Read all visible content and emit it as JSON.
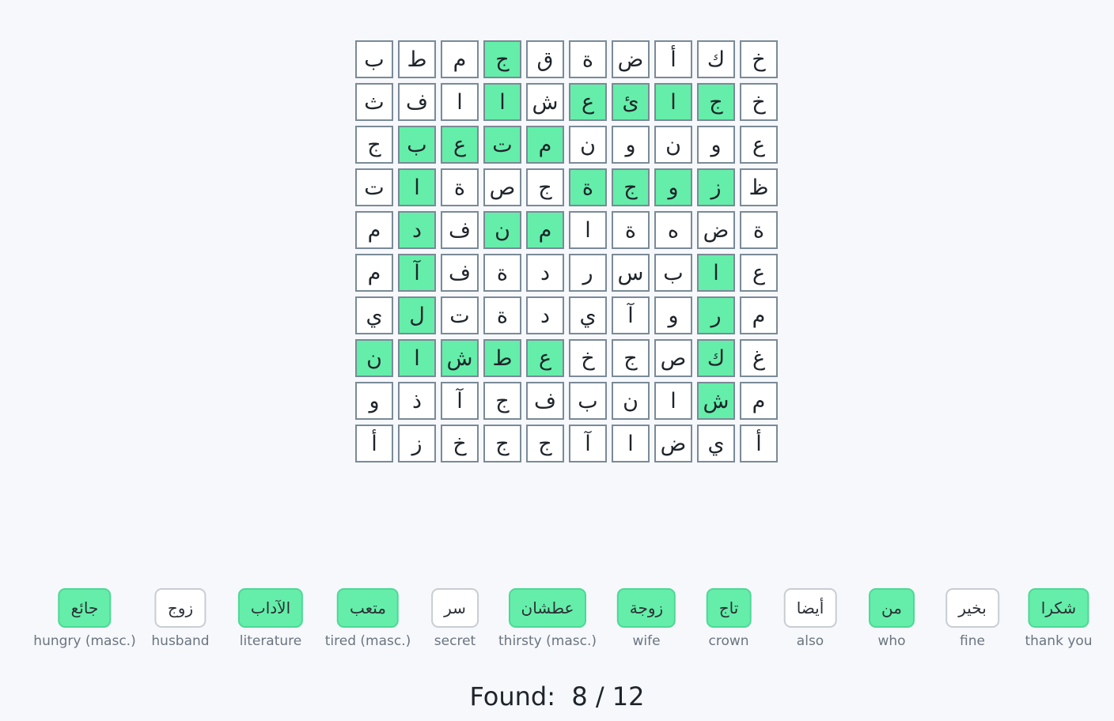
{
  "grid": {
    "rows": [
      [
        "خ",
        "ك",
        "أ",
        "ض",
        "ة",
        "ق",
        "ج",
        "م",
        "ط",
        "ب"
      ],
      [
        "خ",
        "ج",
        "ا",
        "ئ",
        "ع",
        "ش",
        "ا",
        "ا",
        "ف",
        "ث"
      ],
      [
        "ع",
        "و",
        "ن",
        "و",
        "ن",
        "م",
        "ت",
        "ع",
        "ب",
        "ج"
      ],
      [
        "ظ",
        "ز",
        "و",
        "ج",
        "ة",
        "ج",
        "ص",
        "ة",
        "ا",
        "ت"
      ],
      [
        "ة",
        "ض",
        "ه",
        "ة",
        "ا",
        "م",
        "ن",
        "ف",
        "د",
        "م"
      ],
      [
        "ع",
        "ا",
        "ب",
        "س",
        "ر",
        "د",
        "ة",
        "ف",
        "آ",
        "م"
      ],
      [
        "م",
        "ر",
        "و",
        "آ",
        "ي",
        "د",
        "ة",
        "ت",
        "ل",
        "ي"
      ],
      [
        "غ",
        "ك",
        "ص",
        "ج",
        "خ",
        "ع",
        "ط",
        "ش",
        "ا",
        "ن"
      ],
      [
        "م",
        "ش",
        "ا",
        "ن",
        "ب",
        "ف",
        "ج",
        "آ",
        "ذ",
        "و"
      ],
      [
        "أ",
        "ي",
        "ض",
        "ا",
        "آ",
        "ج",
        "ج",
        "خ",
        "ز",
        "أ"
      ]
    ],
    "found_cells": [
      [
        0,
        6
      ],
      [
        1,
        1
      ],
      [
        1,
        2
      ],
      [
        1,
        3
      ],
      [
        1,
        4
      ],
      [
        1,
        6
      ],
      [
        2,
        5
      ],
      [
        2,
        6
      ],
      [
        2,
        7
      ],
      [
        2,
        8
      ],
      [
        3,
        1
      ],
      [
        3,
        2
      ],
      [
        3,
        3
      ],
      [
        3,
        4
      ],
      [
        3,
        8
      ],
      [
        4,
        5
      ],
      [
        4,
        6
      ],
      [
        4,
        8
      ],
      [
        5,
        1
      ],
      [
        5,
        8
      ],
      [
        6,
        1
      ],
      [
        6,
        8
      ],
      [
        7,
        1
      ],
      [
        7,
        5
      ],
      [
        7,
        6
      ],
      [
        7,
        7
      ],
      [
        7,
        8
      ],
      [
        7,
        9
      ],
      [
        8,
        1
      ]
    ]
  },
  "words": [
    {
      "arabic": "شكرا",
      "english": "thank you",
      "found": true
    },
    {
      "arabic": "بخير",
      "english": "fine",
      "found": false
    },
    {
      "arabic": "من",
      "english": "who",
      "found": true
    },
    {
      "arabic": "أيضا",
      "english": "also",
      "found": false
    },
    {
      "arabic": "تاج",
      "english": "crown",
      "found": true
    },
    {
      "arabic": "زوجة",
      "english": "wife",
      "found": true
    },
    {
      "arabic": "عطشان",
      "english": "thirsty (masc.)",
      "found": true
    },
    {
      "arabic": "سر",
      "english": "secret",
      "found": false
    },
    {
      "arabic": "متعب",
      "english": "tired (masc.)",
      "found": true
    },
    {
      "arabic": "الآداب",
      "english": "literature",
      "found": true
    },
    {
      "arabic": "زوج",
      "english": "husband",
      "found": false
    },
    {
      "arabic": "جائع",
      "english": "hungry (masc.)",
      "found": true
    }
  ],
  "status": {
    "label": "Found:",
    "found": 8,
    "total": 12,
    "text": "Found:  8 / 12"
  },
  "colors": {
    "found": "#64eea9",
    "cell_border": "#7a8a97",
    "background": "#f6f8fc"
  }
}
